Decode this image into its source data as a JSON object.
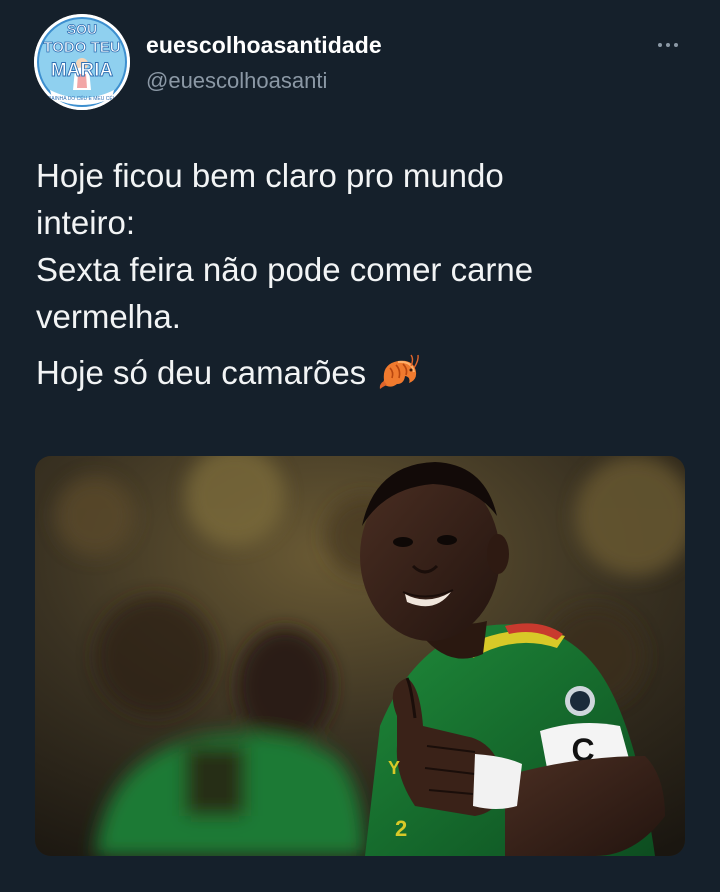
{
  "author": {
    "display_name": "euescolhoasantidade",
    "handle": "@euescolhoasanti",
    "avatar_text": {
      "top": "SOU",
      "middle": "TODO TEU",
      "bottom": "MARIA",
      "caption": "RAINHA DO CÉU E MEU CÉU"
    }
  },
  "tweet": {
    "lines": [
      "Hoje ficou bem claro pro mundo",
      "inteiro:",
      "Sexta feira não pode comer carne",
      "vermelha."
    ],
    "line2": "Hoje só deu camarões"
  },
  "media": {
    "armband_letter": "C"
  },
  "colors": {
    "background": "#15202b",
    "text": "#ffffff",
    "secondary": "#8b98a5"
  }
}
